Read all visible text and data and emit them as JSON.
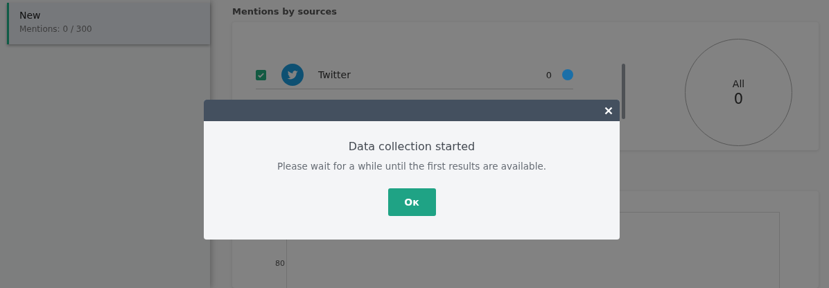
{
  "sidebar": {
    "items": [
      {
        "title": "New",
        "subtitle": "Mentions: 0 / 300",
        "selected": true
      }
    ]
  },
  "sources": {
    "title": "Mentions by sources",
    "items": [
      {
        "name": "Twitter",
        "checked": true,
        "count": "0",
        "color": "#1a6fa8"
      }
    ],
    "total": {
      "label": "All",
      "value": "0"
    }
  },
  "chart": {
    "y_tick": "80"
  },
  "dialog": {
    "title": "Data collection started",
    "message": "Please wait for a while until the first results are available.",
    "button": "Oк"
  }
}
